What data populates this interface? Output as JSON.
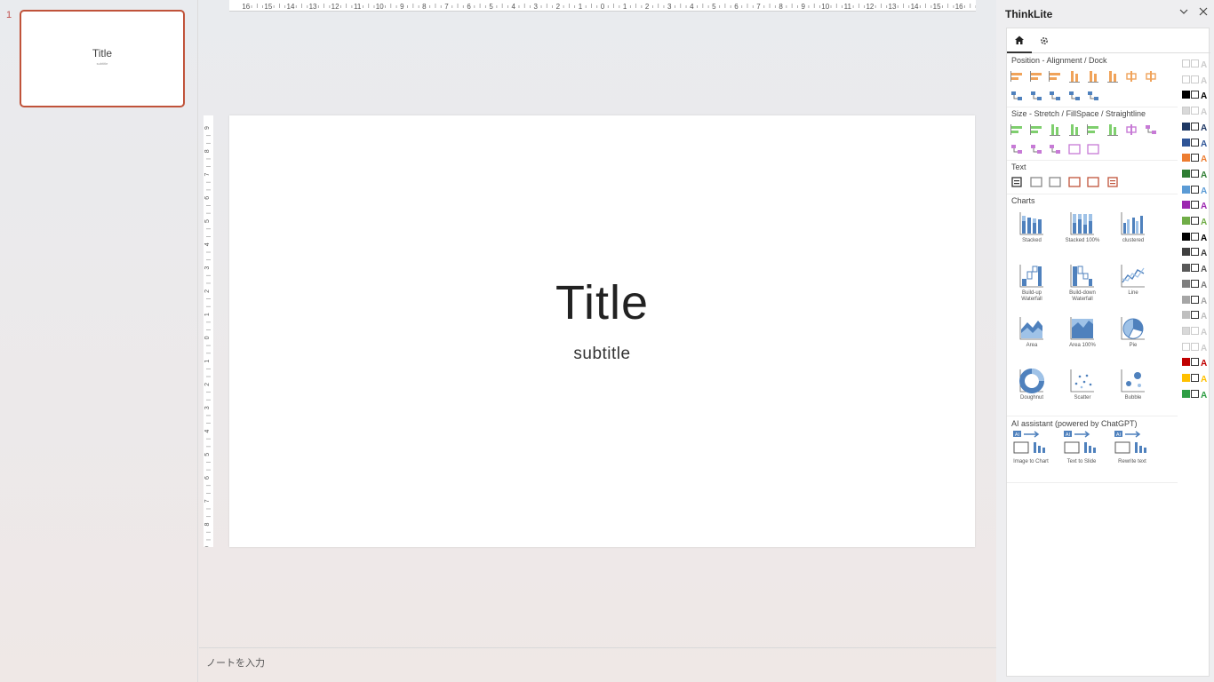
{
  "thumbnails": [
    {
      "number": "1",
      "title": "Title",
      "subtitle": "subtitle"
    }
  ],
  "ruler": {
    "horizontal": [
      "16",
      "15",
      "14",
      "13",
      "12",
      "11",
      "10",
      "9",
      "8",
      "7",
      "6",
      "5",
      "4",
      "3",
      "2",
      "1",
      "0",
      "1",
      "2",
      "3",
      "4",
      "5",
      "6",
      "7",
      "8",
      "9",
      "10",
      "11",
      "12",
      "13",
      "14",
      "15",
      "16"
    ],
    "vertical": [
      "9",
      "8",
      "7",
      "6",
      "5",
      "4",
      "3",
      "2",
      "1",
      "0",
      "1",
      "2",
      "3",
      "4",
      "5",
      "6",
      "7",
      "8",
      "9"
    ]
  },
  "slide": {
    "title": "Title",
    "subtitle": "subtitle"
  },
  "notes": {
    "placeholder": "ノートを入力"
  },
  "pane": {
    "title": "ThinkLite",
    "sections": {
      "position": "Position - Alignment / Dock",
      "size": "Size - Stretch / FillSpace / Straightline",
      "text": "Text",
      "charts": "Charts",
      "ai": "AI assistant (powered by ChatGPT)"
    },
    "charts": [
      {
        "key": "stacked",
        "label": "Stacked"
      },
      {
        "key": "stacked100",
        "label": "Stacked 100%"
      },
      {
        "key": "clustered",
        "label": "clustered"
      },
      {
        "key": "buildup",
        "label": "Build-up Waterfall"
      },
      {
        "key": "builddown",
        "label": "Build-down Waterfall"
      },
      {
        "key": "line",
        "label": "Line"
      },
      {
        "key": "area",
        "label": "Area"
      },
      {
        "key": "area100",
        "label": "Area 100%"
      },
      {
        "key": "pie",
        "label": "Pie"
      },
      {
        "key": "doughnut",
        "label": "Doughnut"
      },
      {
        "key": "scatter",
        "label": "Scatter"
      },
      {
        "key": "bubble",
        "label": "Bubble"
      }
    ],
    "ai_tools": [
      {
        "key": "img2chart",
        "label": "Image to Chart"
      },
      {
        "key": "text2slide",
        "label": "Text to Slide"
      },
      {
        "key": "rewrite",
        "label": "Rewrite text"
      }
    ],
    "ai_badge": "AI",
    "swatch_letter": "A",
    "swatch_colors": [
      "#ffffff",
      "#ffffff",
      "#000000",
      "#d9d9d9",
      "#1f3864",
      "#2f5597",
      "#ed7d31",
      "#2e7d32",
      "#5b9bd5",
      "#9c27b0",
      "#70ad47",
      "#000000",
      "#404040",
      "#595959",
      "#7f7f7f",
      "#a6a6a6",
      "#bfbfbf",
      "#d9d9d9",
      "#ffffff",
      "#c00000",
      "#ffc000",
      "#2e9e44"
    ],
    "colors": {
      "orange": "#f0a35a",
      "green": "#7fcf6e",
      "purple": "#c77ad6",
      "blue": "#4f81bd",
      "accent": "#c0533a"
    }
  }
}
